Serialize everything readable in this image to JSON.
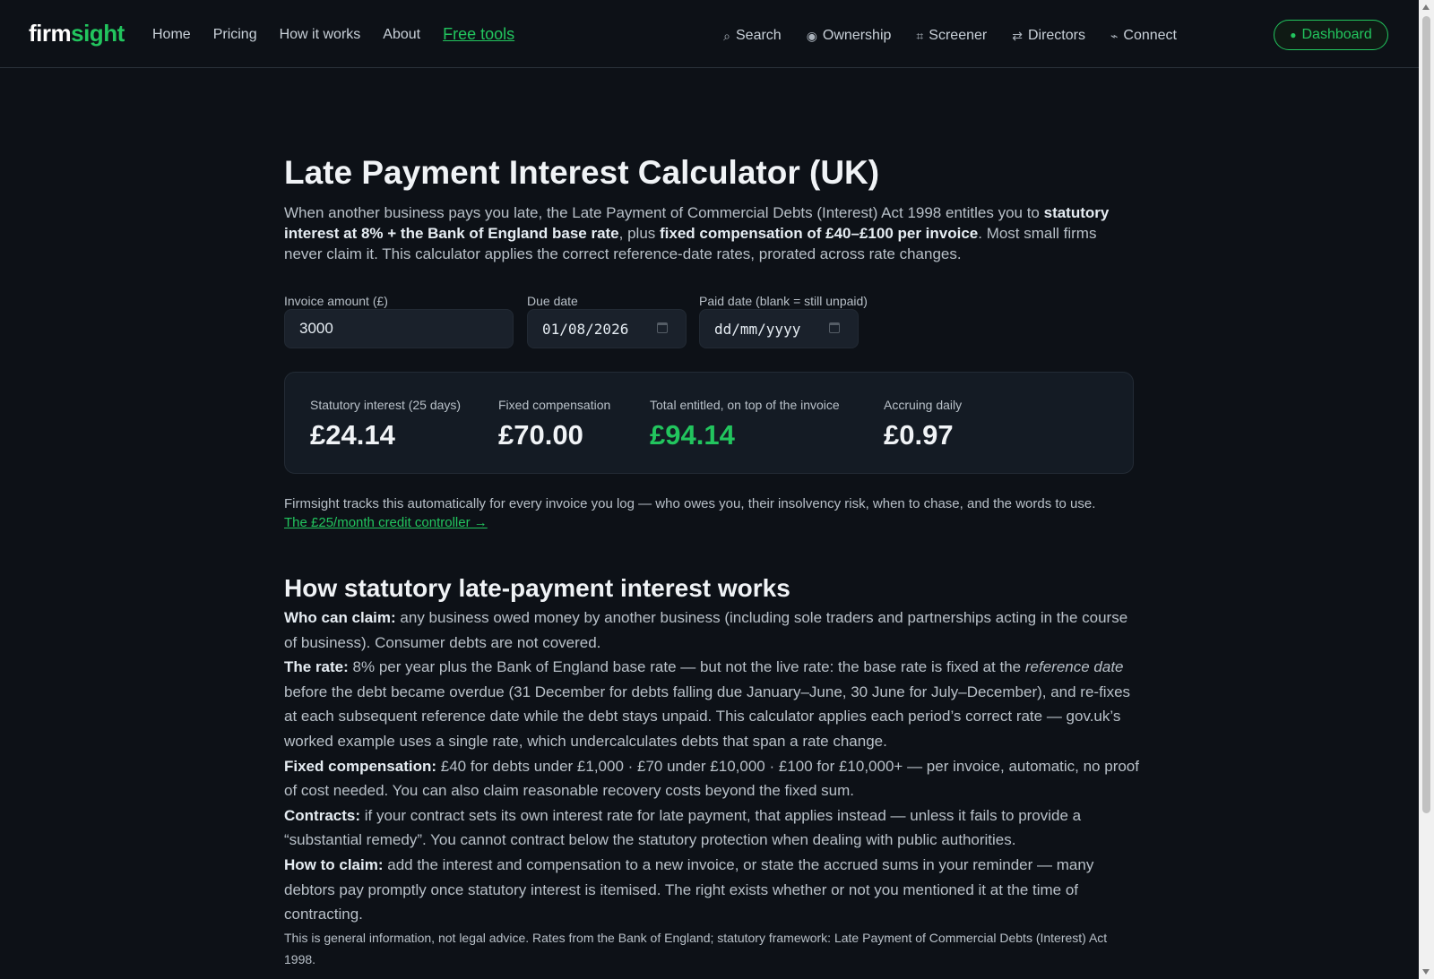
{
  "nav": {
    "logo_part1": "firm",
    "logo_part2": "sight",
    "links": [
      "Home",
      "Pricing",
      "How it works",
      "About"
    ],
    "free_tools": "Free tools",
    "right": [
      {
        "icon": "search-icon",
        "glyph": "⌕",
        "label": "Search"
      },
      {
        "icon": "ownership-icon",
        "glyph": "◉",
        "label": "Ownership"
      },
      {
        "icon": "screener-icon",
        "glyph": "⌗",
        "label": "Screener"
      },
      {
        "icon": "directors-icon",
        "glyph": "⇄",
        "label": "Directors"
      },
      {
        "icon": "connect-icon",
        "glyph": "⌁",
        "label": "Connect"
      }
    ],
    "dashboard": "Dashboard"
  },
  "page": {
    "title": "Late Payment Interest Calculator (UK)",
    "intro_1": "When another business pays you late, the Late Payment of Commercial Debts (Interest) Act 1998 entitles you to ",
    "intro_b1": "statutory interest at 8% + the Bank of England base rate",
    "intro_2": ", plus ",
    "intro_b2": "fixed compensation of £40–£100 per invoice",
    "intro_3": ". Most small firms never claim it. This calculator applies the correct reference-date rates, prorated across rate changes."
  },
  "form": {
    "invoice_label": "Invoice amount (£)",
    "invoice_value": "3000",
    "due_label": "Due date",
    "due_value": "01/08/2026",
    "paid_label": "Paid date (blank = still unpaid)",
    "paid_placeholder": "dd/mm/yyyy"
  },
  "results": {
    "interest_label": "Statutory interest (25 days)",
    "interest_value": "£24.14",
    "comp_label": "Fixed compensation",
    "comp_value": "£70.00",
    "total_label": "Total entitled, on top of the invoice",
    "total_value": "£94.14",
    "daily_label": "Accruing daily",
    "daily_value": "£0.97"
  },
  "promo": {
    "text": "Firmsight tracks this automatically for every invoice you log — who owes you, their insolvency risk, when to chase, and the words to use.",
    "link": "The £25/month credit controller →"
  },
  "how": {
    "heading": "How statutory late-payment interest works",
    "who_b": "Who can claim:",
    "who_t": " any business owed money by another business (including sole traders and partnerships acting in the course of business). Consumer debts are not covered.",
    "rate_b": "The rate:",
    "rate_t1": " 8% per year plus the Bank of England base rate — but not the live rate: the base rate is fixed at the ",
    "rate_i": "reference date",
    "rate_t2": " before the debt became overdue (31 December for debts falling due January–June, 30 June for July–December), and re-fixes at each subsequent reference date while the debt stays unpaid. This calculator applies each period’s correct rate — gov.uk’s worked example uses a single rate, which undercalculates debts that span a rate change.",
    "fixed_b": "Fixed compensation:",
    "fixed_t": " £40 for debts under £1,000 · £70 under £10,000 · £100 for £10,000+ — per invoice, automatic, no proof of cost needed. You can also claim reasonable recovery costs beyond the fixed sum.",
    "contracts_b": "Contracts:",
    "contracts_t": " if your contract sets its own interest rate for late payment, that applies instead — unless it fails to provide a “substantial remedy”. You cannot contract below the statutory protection when dealing with public authorities.",
    "claim_b": "How to claim:",
    "claim_t": " add the interest and compensation to a new invoice, or state the accrued sums in your reminder — many debtors pay promptly once statutory interest is itemised. The right exists whether or not you mentioned it at the time of contracting.",
    "disclaimer": "This is general information, not legal advice. Rates from the Bank of England; statutory framework: Late Payment of Commercial Debts (Interest) Act 1998."
  }
}
